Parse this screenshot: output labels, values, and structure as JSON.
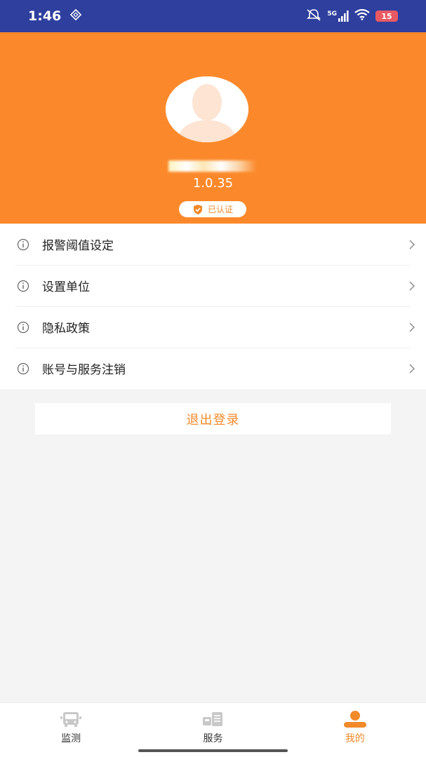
{
  "status_bar": {
    "time": "1:46",
    "network": "5G",
    "battery": "15",
    "colors": {
      "background": "#2f3f9e"
    }
  },
  "profile": {
    "version": "1.0.35",
    "verified_label": "已认证",
    "colors": {
      "header": "#fb892b",
      "accent": "#f28a2a"
    }
  },
  "menu": {
    "items": [
      {
        "label": "报警阈值设定",
        "icon": "info-icon"
      },
      {
        "label": "设置单位",
        "icon": "info-icon"
      },
      {
        "label": "隐私政策",
        "icon": "info-icon"
      },
      {
        "label": "账号与服务注销",
        "icon": "info-icon"
      }
    ]
  },
  "logout": {
    "label": "退出登录"
  },
  "bottom_nav": {
    "tabs": [
      {
        "label": "监测",
        "icon": "truck-monitor-icon",
        "active": false
      },
      {
        "label": "服务",
        "icon": "service-icon",
        "active": false
      },
      {
        "label": "我的",
        "icon": "profile-icon",
        "active": true
      }
    ]
  }
}
